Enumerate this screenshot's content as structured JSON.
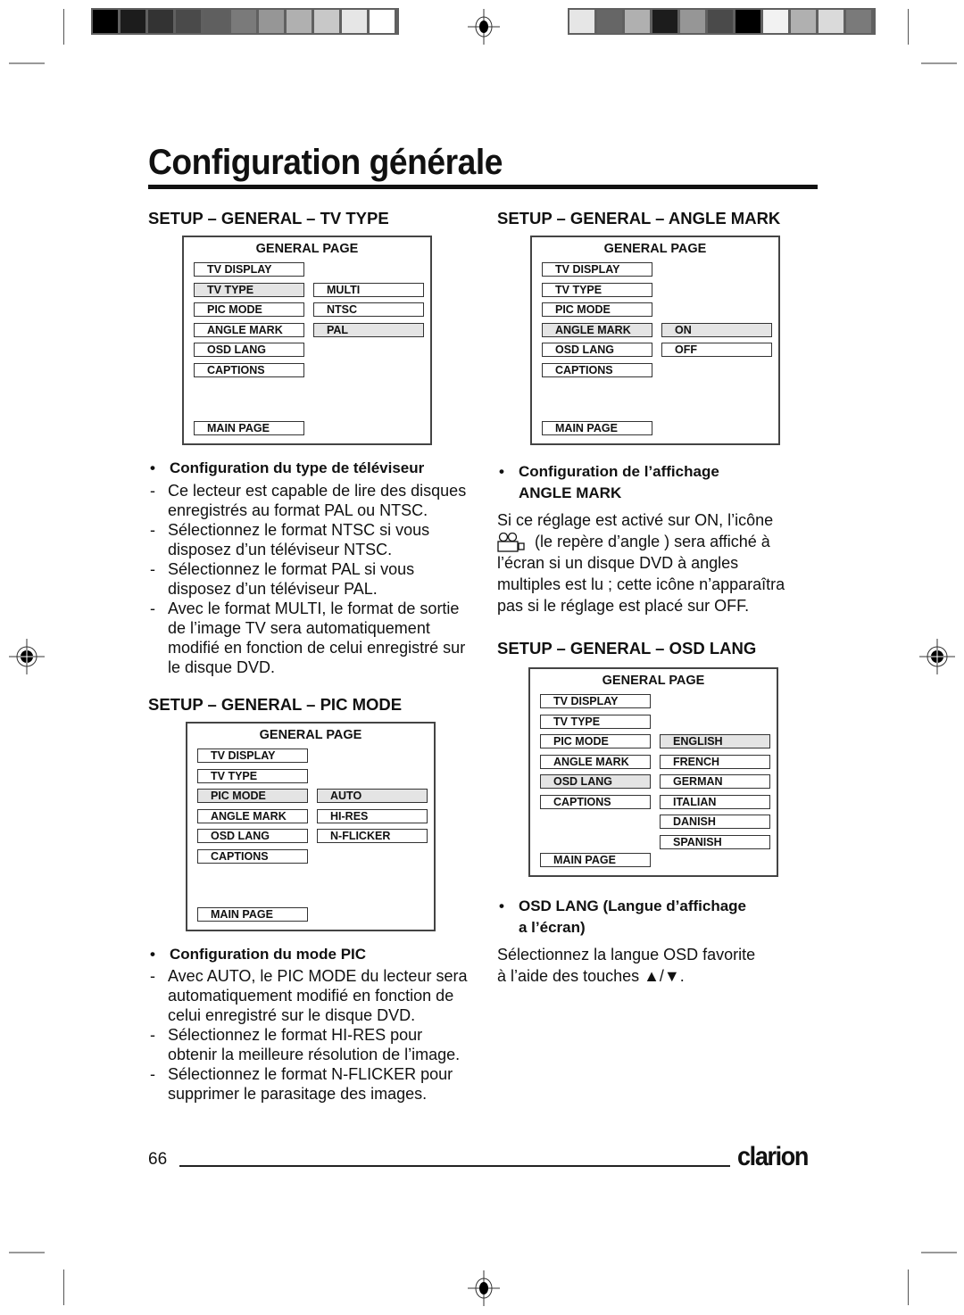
{
  "page": {
    "title": "Configuration générale",
    "page_number": "66",
    "brand": "clarion"
  },
  "color_bars": {
    "left": [
      "#000000",
      "#1c1c1c",
      "#333333",
      "#4a4a4a",
      "#5f5f5f",
      "#7a7a7a",
      "#969696",
      "#b0b0b0",
      "#c8c8c8",
      "#e6e6e6",
      "#ffffff"
    ],
    "right": [
      "#e6e6e6",
      "#666666",
      "#b0b0b0",
      "#1c1c1c",
      "#969696",
      "#4a4a4a",
      "#000000",
      "#f2f2f2",
      "#b0b0b0",
      "#dadada",
      "#7a7a7a"
    ]
  },
  "sections": {
    "tv_type": {
      "heading": "SETUP – GENERAL – TV TYPE",
      "menu": {
        "title": "GENERAL PAGE",
        "left_items": [
          "TV DISPLAY",
          "TV TYPE",
          "PIC MODE",
          "ANGLE MARK",
          "OSD LANG",
          "CAPTIONS"
        ],
        "main_page": "MAIN PAGE",
        "selected_left": "TV TYPE",
        "right_items": [
          "MULTI",
          "NTSC",
          "PAL"
        ],
        "selected_right": "PAL"
      },
      "bullet": "Configuration du type de téléviseur",
      "items": [
        "Ce lecteur est capable de lire des disques enregistrés au format PAL ou NTSC.",
        "Sélectionnez le format NTSC si vous disposez d’un téléviseur NTSC.",
        "Sélectionnez le format PAL si vous disposez d’un téléviseur PAL.",
        "Avec le format MULTI, le format de sortie de l’image TV sera automatiquement modifié en fonction de celui enregistré sur le disque DVD."
      ]
    },
    "pic_mode": {
      "heading": "SETUP – GENERAL – PIC MODE",
      "menu": {
        "title": "GENERAL PAGE",
        "left_items": [
          "TV DISPLAY",
          "TV TYPE",
          "PIC MODE",
          "ANGLE MARK",
          "OSD LANG",
          "CAPTIONS"
        ],
        "main_page": "MAIN PAGE",
        "selected_left": "PIC MODE",
        "right_items": [
          "AUTO",
          "HI-RES",
          "N-FLICKER"
        ],
        "selected_right": "AUTO"
      },
      "bullet": "Configuration du mode PIC",
      "items": [
        "Avec AUTO, le PIC MODE du lecteur sera automatiquement modifié en fonction de celui enregistré sur le disque DVD.",
        "Sélectionnez le format HI-RES pour obtenir la meilleure résolution de l’image.",
        "Sélectionnez le format N-FLICKER pour supprimer le parasitage des images."
      ]
    },
    "angle_mark": {
      "heading": "SETUP – GENERAL – ANGLE MARK",
      "menu": {
        "title": "GENERAL PAGE",
        "left_items": [
          "TV DISPLAY",
          "TV TYPE",
          "PIC MODE",
          "ANGLE MARK",
          "OSD LANG",
          "CAPTIONS"
        ],
        "main_page": "MAIN PAGE",
        "selected_left": "ANGLE MARK",
        "right_items": [
          "ON",
          "OFF"
        ],
        "selected_right": "ON"
      },
      "bullet_line1": "Configuration de l’affichage",
      "bullet_line2": "ANGLE MARK",
      "para_line1": "Si ce réglage est activé sur ON, l’icône",
      "para_line2": "(le repère d’angle ) sera affiché à",
      "para_line3": "l’écran si un disque DVD  à angles",
      "para_line4": "multiples est lu ; cette icône n’apparaîtra",
      "para_line5": "pas si le réglage est placé sur OFF.",
      "icon": "camera-angle-icon"
    },
    "osd_lang": {
      "heading": "SETUP – GENERAL – OSD LANG",
      "menu": {
        "title": "GENERAL PAGE",
        "left_items": [
          "TV DISPLAY",
          "TV TYPE",
          "PIC MODE",
          "ANGLE MARK",
          "OSD LANG",
          "CAPTIONS"
        ],
        "main_page": "MAIN PAGE",
        "selected_left": "OSD LANG",
        "right_items": [
          "ENGLISH",
          "FRENCH",
          "GERMAN",
          "ITALIAN",
          "DANISH",
          "SPANISH"
        ],
        "selected_right": "ENGLISH"
      },
      "bullet_line1": "OSD LANG (Langue d’affichage",
      "bullet_line2": "a l’écran)",
      "para_line1": "Sélectionnez la langue OSD favorite",
      "para_line2": "à l’aide des touches ▲/▼."
    }
  }
}
